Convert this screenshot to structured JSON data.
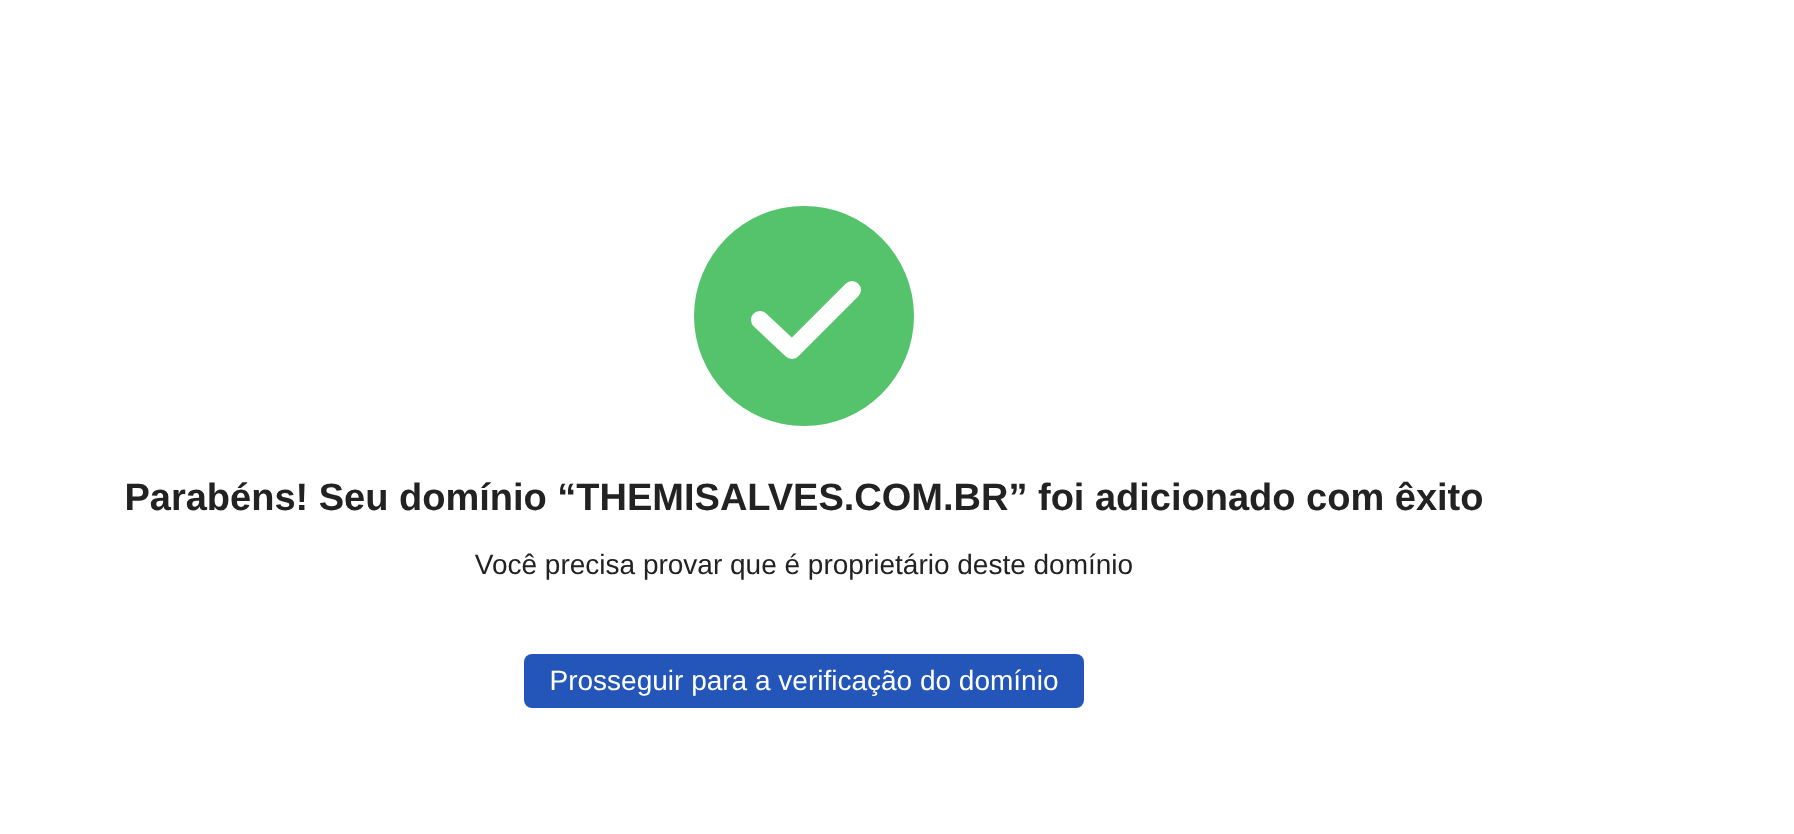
{
  "title": "Parabéns! Seu domínio “THEMISALVES.COM.BR” foi adicionado com êxito",
  "subtitle": "Você precisa provar que é proprietário deste domínio",
  "button": "Prosseguir para a verificação do domínio"
}
